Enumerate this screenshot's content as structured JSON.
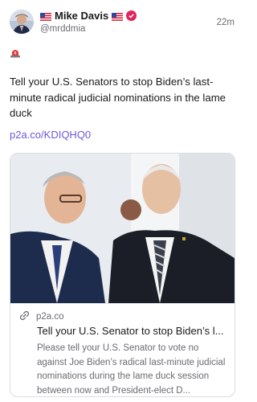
{
  "author": {
    "display_name": "Mike Davis",
    "handle": "@mrddmia",
    "flag_icon": "us-flag-icon",
    "verified_icon": "verified-badge-icon",
    "verified_color": "#e0245e"
  },
  "timestamp": "22m",
  "post": {
    "emoji_icon": "rotating-light-icon",
    "text": "Tell your U.S. Senators to stop Biden’s last-minute radical judicial nominations in the lame duck",
    "link": "p2a.co/KDIQHQ0"
  },
  "link_card": {
    "domain": "p2a.co",
    "title": "Tell your U.S. Senator to stop Biden’s l...",
    "description": "Please tell your U.S. Senator to vote no against Joe Biden’s radical last-minute judicial nominations during the lame duck session between now and President-elect D...",
    "link_icon": "link-icon"
  },
  "colors": {
    "accent": "#6b59e0",
    "muted": "#6b6b73"
  }
}
